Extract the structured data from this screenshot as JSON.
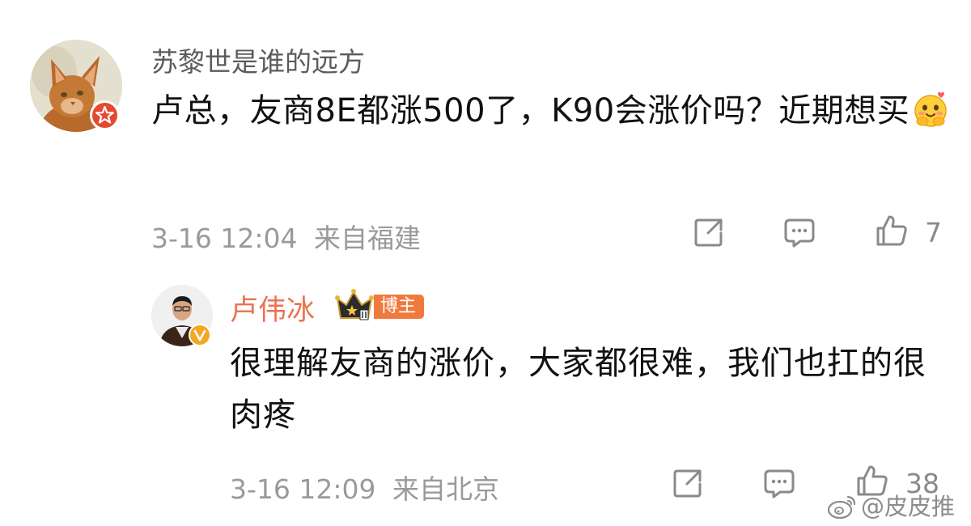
{
  "comment": {
    "username": "苏黎世是谁的远方",
    "text": "卢总，友商8E都涨500了，K90会涨价吗？近期想买",
    "timestamp": "3-16 12:04",
    "location": "来自福建",
    "likes": "7",
    "avatar_icon": "cat-avatar",
    "verify_icon": "red-verified-badge-icon",
    "emoji_icon": "hug-emoji-icon"
  },
  "reply": {
    "username": "卢伟冰",
    "badge": "博主",
    "text": "很理解友商的涨价，大家都很难，我们也扛的很肉疼",
    "timestamp": "3-16 12:09",
    "location": "来自北京",
    "likes": "38",
    "avatar_icon": "man-avatar",
    "verify_icon": "gold-verified-badge-icon",
    "crown_icon": "crown-level-icon"
  },
  "watermark": {
    "text": "@皮皮推",
    "logo_icon": "weibo-logo-icon"
  },
  "colors": {
    "username_gray": "#5b5b5b",
    "reply_username_orange": "#eb7350",
    "meta_gray": "#9a9a9a",
    "badge_orange": "#f07a3e",
    "verify_red": "#e6492f",
    "verify_gold": "#f5a623"
  }
}
